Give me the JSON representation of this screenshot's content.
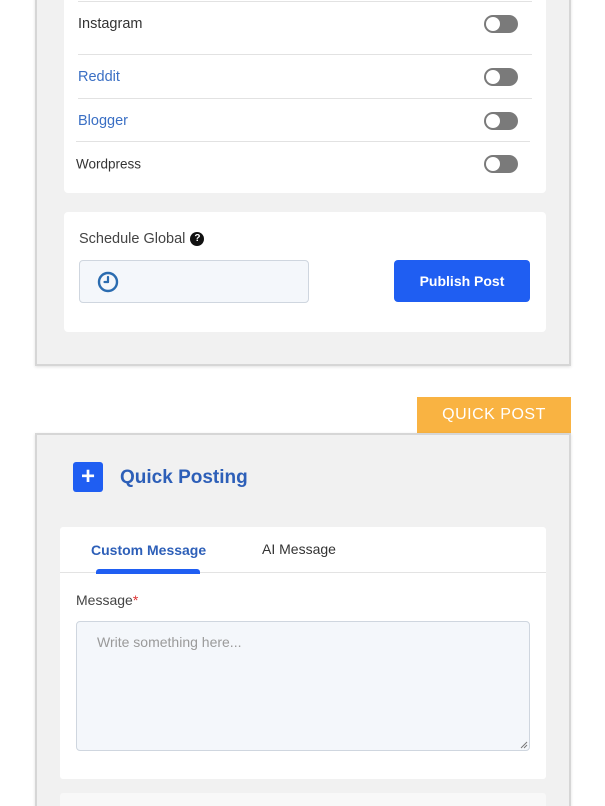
{
  "social_accounts": [
    {
      "label": "Instagram",
      "style": "dark",
      "enabled": false
    },
    {
      "label": "Reddit",
      "style": "link",
      "enabled": false
    },
    {
      "label": "Blogger",
      "style": "link",
      "enabled": false
    },
    {
      "label": "Wordpress",
      "style": "dark",
      "enabled": false
    }
  ],
  "schedule": {
    "label": "Schedule Global",
    "help_icon": "?",
    "input_value": "",
    "clock_icon": "clock-icon"
  },
  "publish_button": {
    "label": "Publish Post"
  },
  "quick_post": {
    "tag": "QUICK POST",
    "plus_icon": "+",
    "title": "Quick Posting",
    "tabs": [
      {
        "label": "Custom Message",
        "active": true
      },
      {
        "label": "AI Message",
        "active": false
      }
    ],
    "message": {
      "label": "Message",
      "required_mark": "*",
      "placeholder": "Write something here...",
      "value": ""
    }
  },
  "colors": {
    "primary": "#1f5ef2",
    "link": "#3a6fc4",
    "tag": "#f9b342",
    "toggle_off": "#7a7a7a",
    "panel_bg": "#f1f1f1"
  }
}
